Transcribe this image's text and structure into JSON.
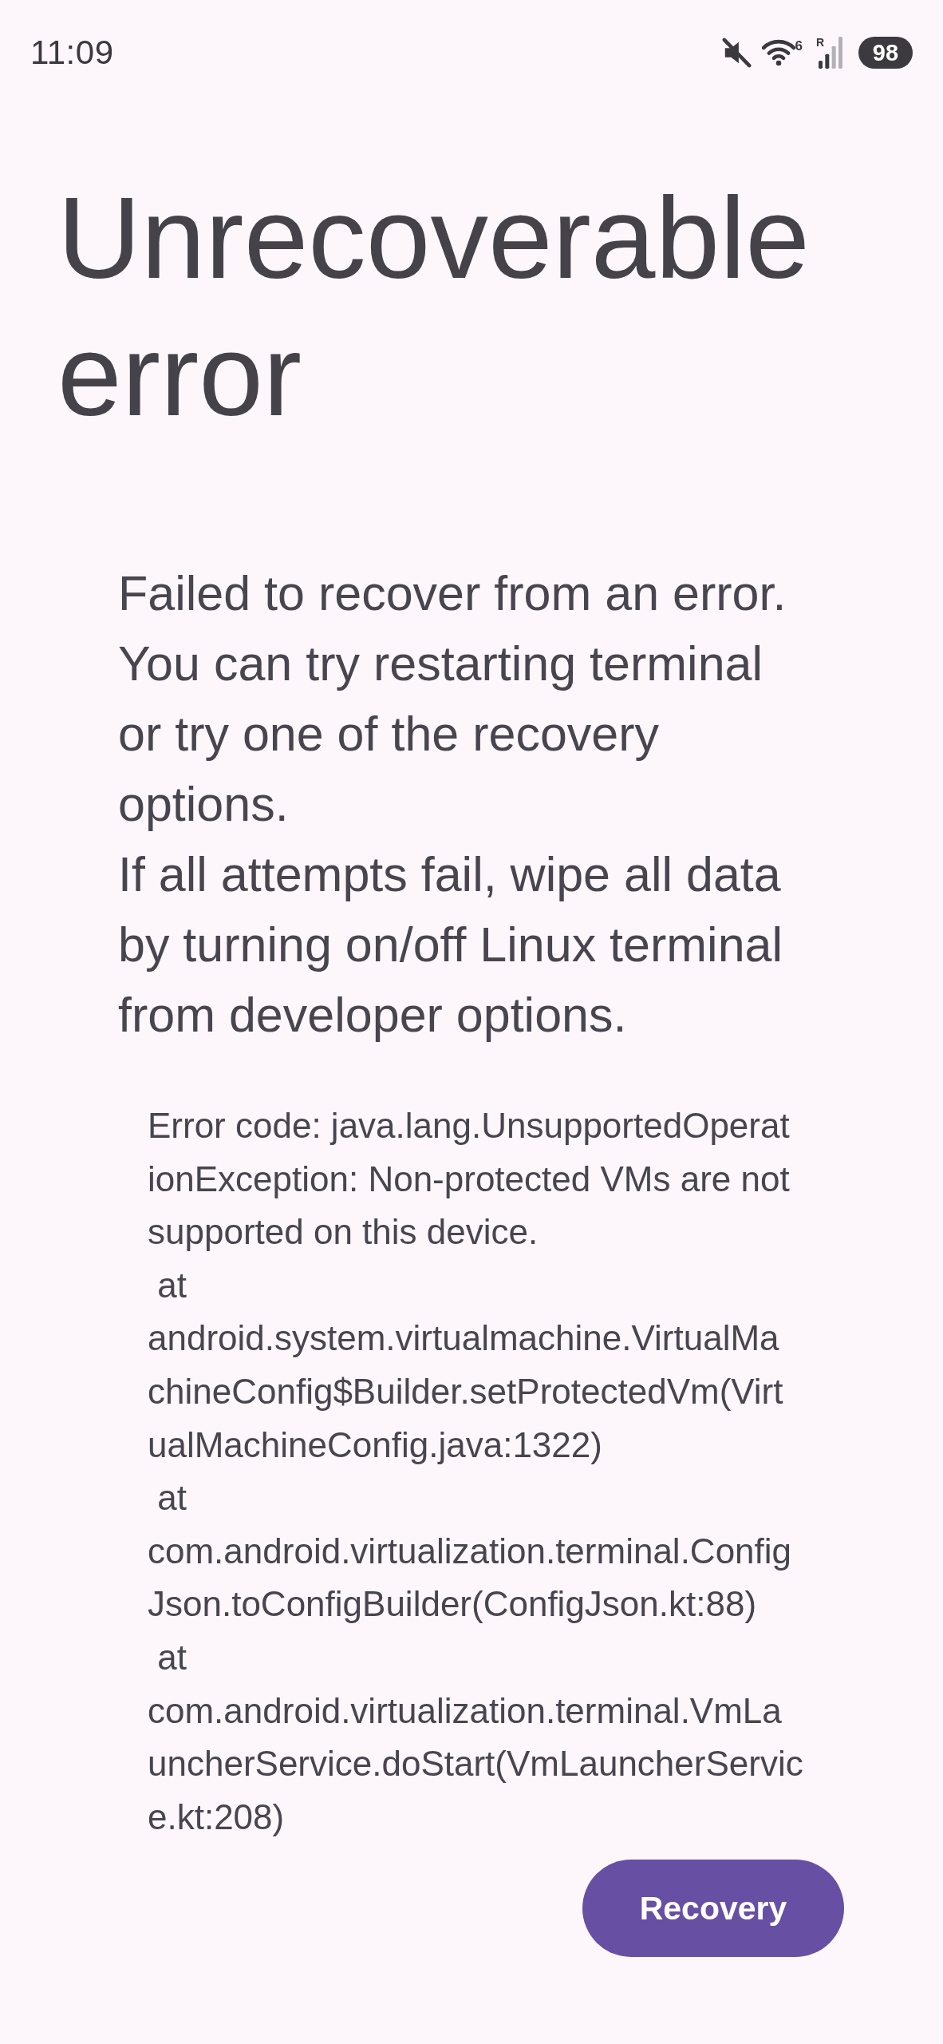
{
  "status_bar": {
    "time": "11:09",
    "wifi_label": "6",
    "signal_label": "R",
    "battery": "98"
  },
  "title": "Unrecoverable error",
  "message": [
    "Failed to recover from an error. You can try restarting terminal or try one of the recovery options.",
    "If all attempts fail, wipe all data by turning on/off Linux terminal from developer options."
  ],
  "error_details": "Error code: java.lang.UnsupportedOperat\nionException: Non-protected VMs are not\nsupported on this device.\n at\nandroid.system.virtualmachine.VirtualMa\nchineConfig$Builder.setProtectedVm(Virt\nualMachineConfig.java:1322)\n at\ncom.android.virtualization.terminal.Config\nJson.toConfigBuilder(ConfigJson.kt:88)\n at\ncom.android.virtualization.terminal.VmLa\nuncherService.doStart(VmLauncherServic\ne.kt:208)",
  "button": "Recovery"
}
